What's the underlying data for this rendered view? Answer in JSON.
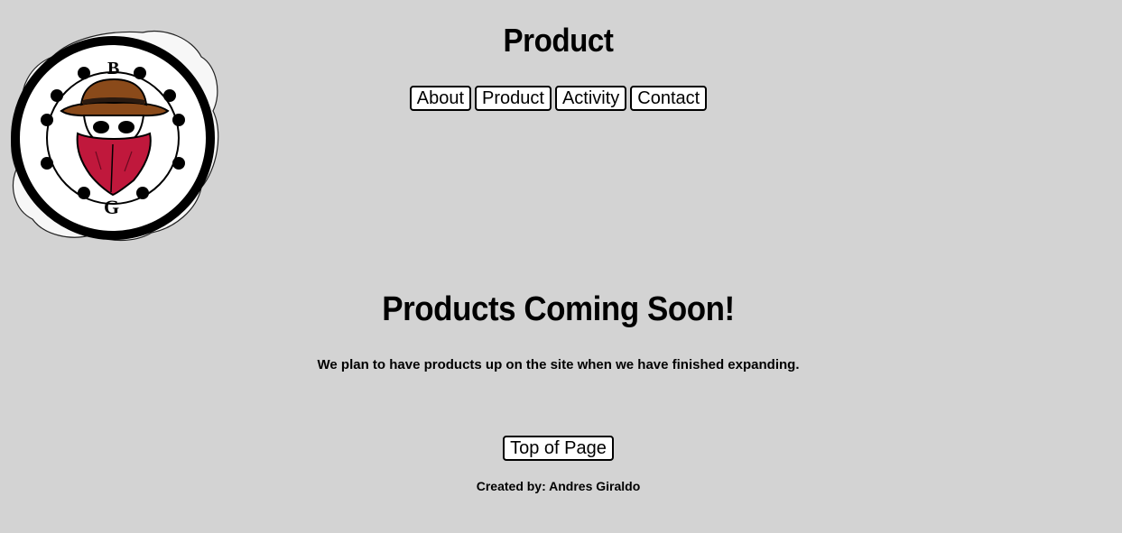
{
  "header": {
    "title": "Product"
  },
  "logo": {
    "top_letter": "B",
    "bottom_letter": "G"
  },
  "nav": {
    "items": [
      {
        "label": "About"
      },
      {
        "label": "Product"
      },
      {
        "label": "Activity"
      },
      {
        "label": "Contact"
      }
    ]
  },
  "main": {
    "heading": "Products Coming Soon!",
    "paragraph": "We plan to have products up on the site when we have finished expanding."
  },
  "footer": {
    "top_button_label": "Top of Page",
    "credit": "Created by: Andres Giraldo"
  },
  "colors": {
    "background": "#d3d3d3",
    "bandana": "#c0183c",
    "hat": "#8a4a1a"
  }
}
